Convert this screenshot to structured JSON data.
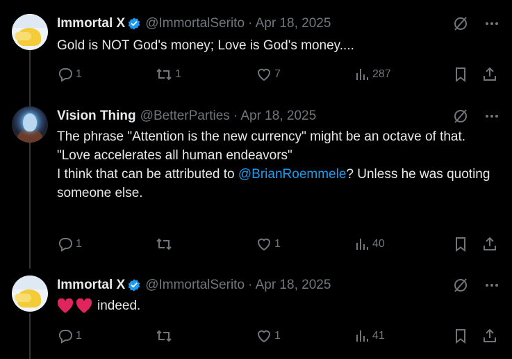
{
  "tweets": [
    {
      "name": "Immortal X",
      "handle": "@ImmortalSerito",
      "date": "· Apr 18, 2025",
      "text": "Gold is NOT God's money; Love is God's money....",
      "replies": "1",
      "reposts": "1",
      "likes": "7",
      "views": "287"
    },
    {
      "name": "Vision Thing",
      "handle": "@BetterParties",
      "date": "· Apr 18, 2025",
      "lines": [
        "The phrase \"Attention is the new currency\" might be an octave of that.",
        "\"Love accelerates all human endeavors\""
      ],
      "line3_pre": "I think that can be attributed to ",
      "mention": "@BrianRoemmele",
      "line3_post": "?  Unless he was quoting someone else.",
      "replies": "1",
      "reposts": "",
      "likes": "1",
      "views": "40"
    },
    {
      "name": "Immortal X",
      "handle": "@ImmortalSerito",
      "date": "· Apr 18, 2025",
      "text": "indeed.",
      "emoji": "heart-emoji",
      "replies": "1",
      "reposts": "",
      "likes": "1",
      "views": "41"
    }
  ],
  "colors": {
    "background": "#000000",
    "text": "#e7e9ea",
    "muted": "#71767b",
    "link": "#1d9bf0",
    "verified": "#1d9bf0",
    "heart": "#e0245e"
  },
  "icons": [
    "reply-icon",
    "repost-icon",
    "like-icon",
    "views-icon",
    "bookmark-icon",
    "share-icon",
    "grok-icon",
    "more-icon",
    "verified-badge-icon"
  ]
}
